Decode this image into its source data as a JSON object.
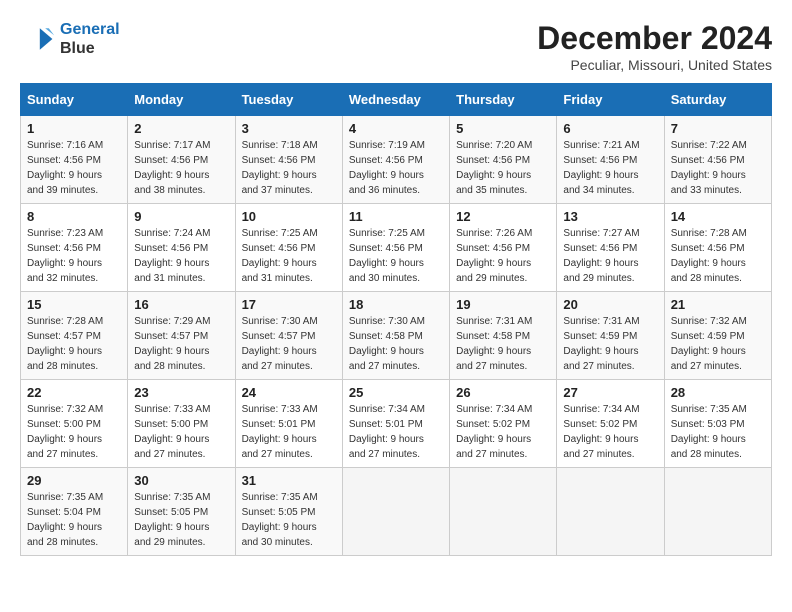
{
  "logo": {
    "line1": "General",
    "line2": "Blue"
  },
  "title": "December 2024",
  "subtitle": "Peculiar, Missouri, United States",
  "header_days": [
    "Sunday",
    "Monday",
    "Tuesday",
    "Wednesday",
    "Thursday",
    "Friday",
    "Saturday"
  ],
  "weeks": [
    [
      {
        "day": "1",
        "sunrise": "7:16 AM",
        "sunset": "4:56 PM",
        "daylight": "9 hours and 39 minutes."
      },
      {
        "day": "2",
        "sunrise": "7:17 AM",
        "sunset": "4:56 PM",
        "daylight": "9 hours and 38 minutes."
      },
      {
        "day": "3",
        "sunrise": "7:18 AM",
        "sunset": "4:56 PM",
        "daylight": "9 hours and 37 minutes."
      },
      {
        "day": "4",
        "sunrise": "7:19 AM",
        "sunset": "4:56 PM",
        "daylight": "9 hours and 36 minutes."
      },
      {
        "day": "5",
        "sunrise": "7:20 AM",
        "sunset": "4:56 PM",
        "daylight": "9 hours and 35 minutes."
      },
      {
        "day": "6",
        "sunrise": "7:21 AM",
        "sunset": "4:56 PM",
        "daylight": "9 hours and 34 minutes."
      },
      {
        "day": "7",
        "sunrise": "7:22 AM",
        "sunset": "4:56 PM",
        "daylight": "9 hours and 33 minutes."
      }
    ],
    [
      {
        "day": "8",
        "sunrise": "7:23 AM",
        "sunset": "4:56 PM",
        "daylight": "9 hours and 32 minutes."
      },
      {
        "day": "9",
        "sunrise": "7:24 AM",
        "sunset": "4:56 PM",
        "daylight": "9 hours and 31 minutes."
      },
      {
        "day": "10",
        "sunrise": "7:25 AM",
        "sunset": "4:56 PM",
        "daylight": "9 hours and 31 minutes."
      },
      {
        "day": "11",
        "sunrise": "7:25 AM",
        "sunset": "4:56 PM",
        "daylight": "9 hours and 30 minutes."
      },
      {
        "day": "12",
        "sunrise": "7:26 AM",
        "sunset": "4:56 PM",
        "daylight": "9 hours and 29 minutes."
      },
      {
        "day": "13",
        "sunrise": "7:27 AM",
        "sunset": "4:56 PM",
        "daylight": "9 hours and 29 minutes."
      },
      {
        "day": "14",
        "sunrise": "7:28 AM",
        "sunset": "4:56 PM",
        "daylight": "9 hours and 28 minutes."
      }
    ],
    [
      {
        "day": "15",
        "sunrise": "7:28 AM",
        "sunset": "4:57 PM",
        "daylight": "9 hours and 28 minutes."
      },
      {
        "day": "16",
        "sunrise": "7:29 AM",
        "sunset": "4:57 PM",
        "daylight": "9 hours and 28 minutes."
      },
      {
        "day": "17",
        "sunrise": "7:30 AM",
        "sunset": "4:57 PM",
        "daylight": "9 hours and 27 minutes."
      },
      {
        "day": "18",
        "sunrise": "7:30 AM",
        "sunset": "4:58 PM",
        "daylight": "9 hours and 27 minutes."
      },
      {
        "day": "19",
        "sunrise": "7:31 AM",
        "sunset": "4:58 PM",
        "daylight": "9 hours and 27 minutes."
      },
      {
        "day": "20",
        "sunrise": "7:31 AM",
        "sunset": "4:59 PM",
        "daylight": "9 hours and 27 minutes."
      },
      {
        "day": "21",
        "sunrise": "7:32 AM",
        "sunset": "4:59 PM",
        "daylight": "9 hours and 27 minutes."
      }
    ],
    [
      {
        "day": "22",
        "sunrise": "7:32 AM",
        "sunset": "5:00 PM",
        "daylight": "9 hours and 27 minutes."
      },
      {
        "day": "23",
        "sunrise": "7:33 AM",
        "sunset": "5:00 PM",
        "daylight": "9 hours and 27 minutes."
      },
      {
        "day": "24",
        "sunrise": "7:33 AM",
        "sunset": "5:01 PM",
        "daylight": "9 hours and 27 minutes."
      },
      {
        "day": "25",
        "sunrise": "7:34 AM",
        "sunset": "5:01 PM",
        "daylight": "9 hours and 27 minutes."
      },
      {
        "day": "26",
        "sunrise": "7:34 AM",
        "sunset": "5:02 PM",
        "daylight": "9 hours and 27 minutes."
      },
      {
        "day": "27",
        "sunrise": "7:34 AM",
        "sunset": "5:02 PM",
        "daylight": "9 hours and 27 minutes."
      },
      {
        "day": "28",
        "sunrise": "7:35 AM",
        "sunset": "5:03 PM",
        "daylight": "9 hours and 28 minutes."
      }
    ],
    [
      {
        "day": "29",
        "sunrise": "7:35 AM",
        "sunset": "5:04 PM",
        "daylight": "9 hours and 28 minutes."
      },
      {
        "day": "30",
        "sunrise": "7:35 AM",
        "sunset": "5:05 PM",
        "daylight": "9 hours and 29 minutes."
      },
      {
        "day": "31",
        "sunrise": "7:35 AM",
        "sunset": "5:05 PM",
        "daylight": "9 hours and 30 minutes."
      },
      null,
      null,
      null,
      null
    ]
  ]
}
